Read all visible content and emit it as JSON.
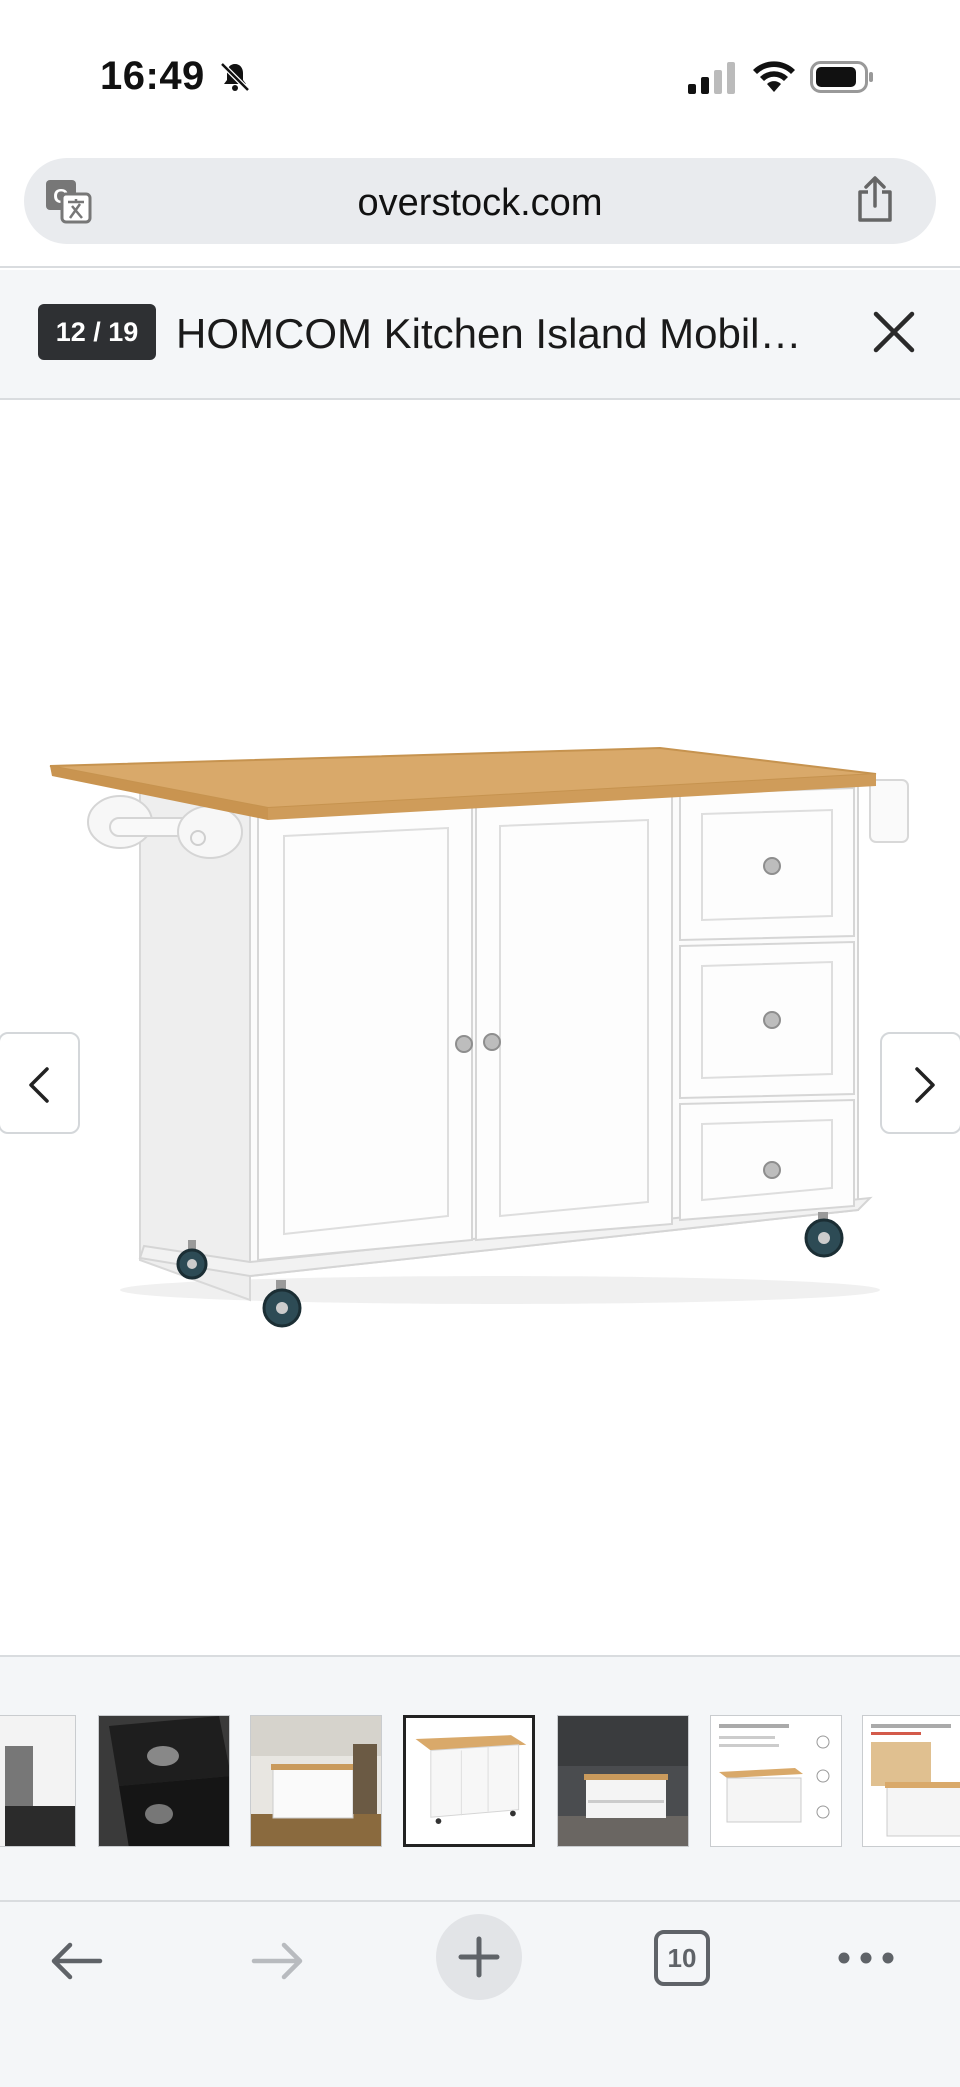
{
  "status_bar": {
    "time": "16:49",
    "icons": [
      "bell-slash-icon",
      "cellular-signal-icon",
      "wifi-icon",
      "battery-icon"
    ]
  },
  "address_bar": {
    "url": "overstock.com",
    "icons": [
      "translate-icon",
      "share-icon"
    ]
  },
  "gallery": {
    "counter": "12 / 19",
    "title": "HOMCOM Kitchen Island Mobil…",
    "close_icon": "close-icon",
    "main_image": "white kitchen island cart with wood top, two doors, three drawers, wheels"
  },
  "thumbnails": [
    {
      "name": "thumbnail-partial",
      "selected": false
    },
    {
      "name": "thumbnail-black-drawers",
      "selected": false
    },
    {
      "name": "thumbnail-kitchen-scene",
      "selected": false
    },
    {
      "name": "thumbnail-white-island",
      "selected": true
    },
    {
      "name": "thumbnail-dark-kitchen",
      "selected": false
    },
    {
      "name": "thumbnail-dimensions-chart",
      "selected": false
    },
    {
      "name": "thumbnail-details-chart",
      "selected": false
    }
  ],
  "toolbar": {
    "tab_count": "10",
    "icons": [
      "back-arrow-icon",
      "forward-arrow-icon",
      "new-tab-plus-icon",
      "tabs-icon",
      "more-dots-icon"
    ]
  },
  "colors": {
    "badge_bg": "#2e3033",
    "chrome_bg": "#f4f6f8",
    "urlbar_bg": "#e9ebee",
    "wood_top": "#d9a96a",
    "cabinet_white": "#fbfbfb"
  }
}
